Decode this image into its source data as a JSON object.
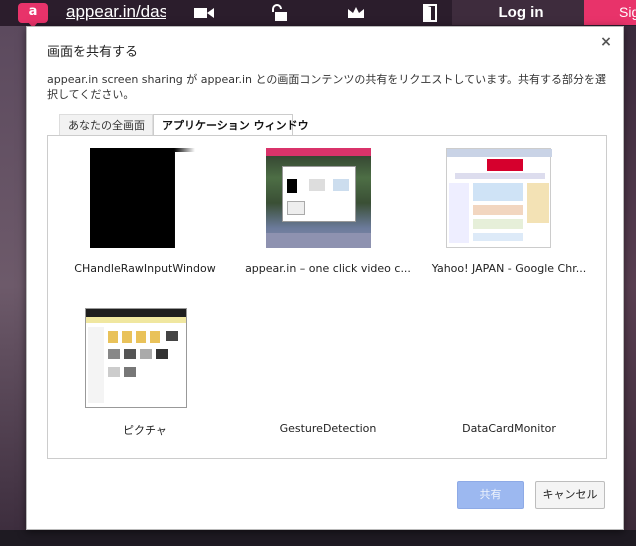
{
  "topbar": {
    "logo_letter": "a",
    "url": "appear.in/das",
    "login_label": "Log in",
    "signup_label": "Sig",
    "icons": [
      "video-icon",
      "lock-icon",
      "crown-icon",
      "door-icon"
    ]
  },
  "dialog": {
    "title": "画面を共有する",
    "description": "appear.in screen sharing が appear.in との画面コンテンツの共有をリクエストしています。共有する部分を選択してください。",
    "tabs": [
      {
        "label": "あなたの全画面",
        "selected": false
      },
      {
        "label": "アプリケーション ウィンドウ",
        "selected": true
      }
    ],
    "windows": [
      {
        "label": "CHandleRawInputWindow"
      },
      {
        "label": "appear.in – one click video c..."
      },
      {
        "label": "Yahoo! JAPAN - Google Chr..."
      },
      {
        "label": "ピクチャ"
      },
      {
        "label": "GestureDetection"
      },
      {
        "label": "DataCardMonitor"
      }
    ],
    "share_label": "共有",
    "cancel_label": "キャンセル",
    "close_icon": "close-icon"
  },
  "colors": {
    "accent_pink": "#e8336a",
    "share_button_disabled": "#9cb8f0"
  }
}
